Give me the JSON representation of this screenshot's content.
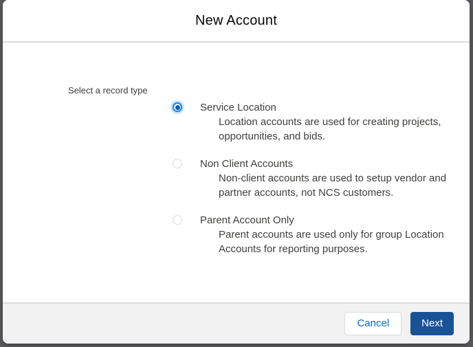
{
  "colors": {
    "accent_blue": "#0070d2",
    "radio_ring": "#1589ee",
    "radio_dot": "#0b5cab",
    "next_bg": "#1a5296",
    "footer_bg": "#f3f2f2",
    "border": "#dddbda",
    "backdrop": "#5b5b5d",
    "text": "#3e3e3c",
    "title_text": "#080707"
  },
  "modal": {
    "title": "New Account",
    "record_type": {
      "label": "Select a record type",
      "options": [
        {
          "title": "Service Location",
          "description": "Location accounts are used for creating projects,\nopportunities, and bids.",
          "selected": true
        },
        {
          "title": "Non Client Accounts",
          "description": "Non-client accounts are used to setup vendor and\npartner accounts, not NCS customers.",
          "selected": false
        },
        {
          "title": "Parent Account Only",
          "description": "Parent accounts are used only for group Location\nAccounts for reporting purposes.",
          "selected": false
        }
      ]
    },
    "footer": {
      "cancel_label": "Cancel",
      "next_label": "Next"
    }
  }
}
